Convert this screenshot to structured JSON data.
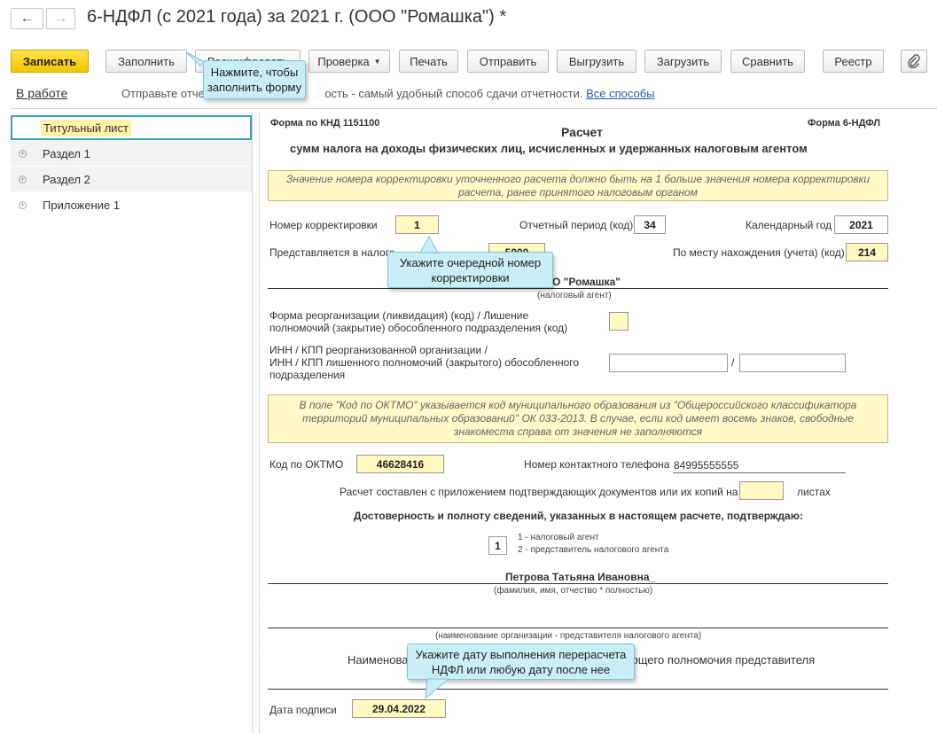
{
  "window": {
    "back_icon": "arrow-left-icon",
    "forward_icon": "arrow-right-icon",
    "title": "6-НДФЛ (с 2021 года) за 2021 г. (ООО \"Ромашка\") *"
  },
  "toolbar": {
    "save": "Записать",
    "fill": "Заполнить",
    "decode": "Расшифровать",
    "check": "Проверка",
    "print": "Печать",
    "send": "Отправить",
    "export": "Выгрузить",
    "import": "Загрузить",
    "compare": "Сравнить",
    "registry": "Реестр",
    "attach_icon": "paperclip-icon",
    "dropdown_icon": "caret-down-icon"
  },
  "status": {
    "state": "В работе",
    "text_before": "Отправьте отчет",
    "text_mid": "ость - самый удобный способ сдачи отчетности.",
    "link_all": "Все способы"
  },
  "tree": {
    "items": [
      {
        "label": "Титульный лист",
        "selected": true
      },
      {
        "label": "Раздел 1"
      },
      {
        "label": "Раздел 2"
      },
      {
        "label": "Приложение 1"
      }
    ]
  },
  "form": {
    "knd": "Форма по КНД 1151100",
    "form_name": "Форма 6-НДФЛ",
    "title": "Расчет",
    "subtitle": "сумм налога на доходы физических лиц, исчисленных и удержанных налоговым агентом",
    "note1": "Значение номера корректировки уточненного расчета должно быть на 1 больше значения номера корректировки расчета, ранее принятого налоговым органом",
    "correction_label": "Номер корректировки",
    "correction_value": "1",
    "period_label": "Отчетный период (код)",
    "period_value": "34",
    "year_label": "Календарный год",
    "year_value": "2021",
    "submitted_label": "Представляется в налого",
    "submitted_value": "5000",
    "location_label": "По месту нахождения (учета) (код)",
    "location_value": "214",
    "org_name": "О \"Ромашка\"",
    "agent_caption": "(налоговый агент)",
    "reorg_label_1": "Форма реорганизации (ликвидация) (код) / Лишение",
    "reorg_label_2": "полномочий (закрытие) обособленного подразделения (код)",
    "inn_label_1": "ИНН / КПП реорганизованной организации /",
    "inn_label_2": "ИНН / КПП лишенного полномочий (закрытого) обособленного",
    "inn_label_3": "подразделения",
    "slash": "/",
    "note2": "В поле \"Код по ОКТМО\" указывается код муниципального образования из \"Общероссийского классификатора территорий муниципальных образований\" ОК 033-2013. В случае, если код имеет восемь знаков, свободные знакоместа справа от значения не заполняются",
    "oktmo_label": "Код по ОКТМО",
    "oktmo_value": "46628416",
    "phone_label": "Номер контактного телефона",
    "phone_value": "84995555555",
    "attach_label": "Расчет составлен с приложением подтверждающих документов или их копий на",
    "sheets_label": "листах",
    "confirm_heading": "Достоверность и полноту сведений, указанных в настоящем расчете, подтверждаю:",
    "signer_code": "1",
    "signer_opt1": "1 - налоговый агент",
    "signer_opt2": "2 - представитель налогового агента",
    "signer_name": "Петрова Татьяна Ивановна_",
    "fio_caption": "(фамилия, имя, отчество * полностью)",
    "org_rep_caption": "(наименование организации - представителя налогового агента)",
    "doc_label_left": "Наименова",
    "doc_label_right": "ющего полномочия представителя",
    "date_label": "Дата подписи",
    "date_value": "29.04.2022"
  },
  "tooltips": {
    "fill": "Нажмите, чтобы заполнить форму",
    "correction": "Укажите очередной номер корректировки",
    "date": "Укажите дату выполнения перерасчета НДФЛ или любую дату после нее"
  }
}
